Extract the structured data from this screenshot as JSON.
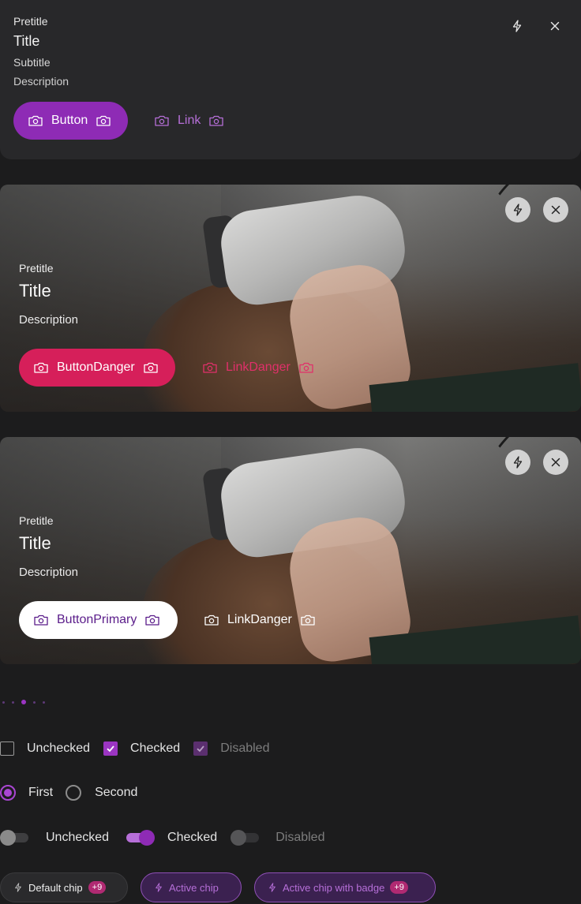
{
  "card1": {
    "pretitle": "Pretitle",
    "title": "Title",
    "subtitle": "Subtitle",
    "description": "Description",
    "button_label": "Button",
    "link_label": "Link"
  },
  "hero1": {
    "pretitle": "Pretitle",
    "title": "Title",
    "description": "Description",
    "button_label": "ButtonDanger",
    "link_label": "LinkDanger"
  },
  "hero2": {
    "pretitle": "Pretitle",
    "title": "Title",
    "description": "Description",
    "button_label": "ButtonPrimary",
    "link_label": "LinkDanger"
  },
  "pagination": {
    "count": 5,
    "active_index": 2
  },
  "checkboxes": [
    {
      "label": "Unchecked",
      "state": "unchecked"
    },
    {
      "label": "Checked",
      "state": "checked"
    },
    {
      "label": "Disabled",
      "state": "disabled-checked"
    }
  ],
  "radios": [
    {
      "label": "First",
      "selected": true
    },
    {
      "label": "Second",
      "selected": false
    }
  ],
  "toggles": [
    {
      "label": "Unchecked",
      "state": "off"
    },
    {
      "label": "Checked",
      "state": "on"
    },
    {
      "label": "Disabled",
      "state": "disabled"
    }
  ],
  "chips": [
    {
      "label": "Default chip",
      "badge": "+9",
      "active": false
    },
    {
      "label": "Active chip",
      "active": true
    },
    {
      "label": "Active chip with badge",
      "badge": "+9",
      "active": true
    }
  ],
  "colors": {
    "accent": "#8e2bb5",
    "accent_light": "#b66fd8",
    "danger": "#d61f5a",
    "badge": "#b02a72",
    "primary_text": "#5a1c8a"
  },
  "icons": {
    "close": "close-icon",
    "flash": "lightning-icon",
    "camera": "camera-icon"
  }
}
